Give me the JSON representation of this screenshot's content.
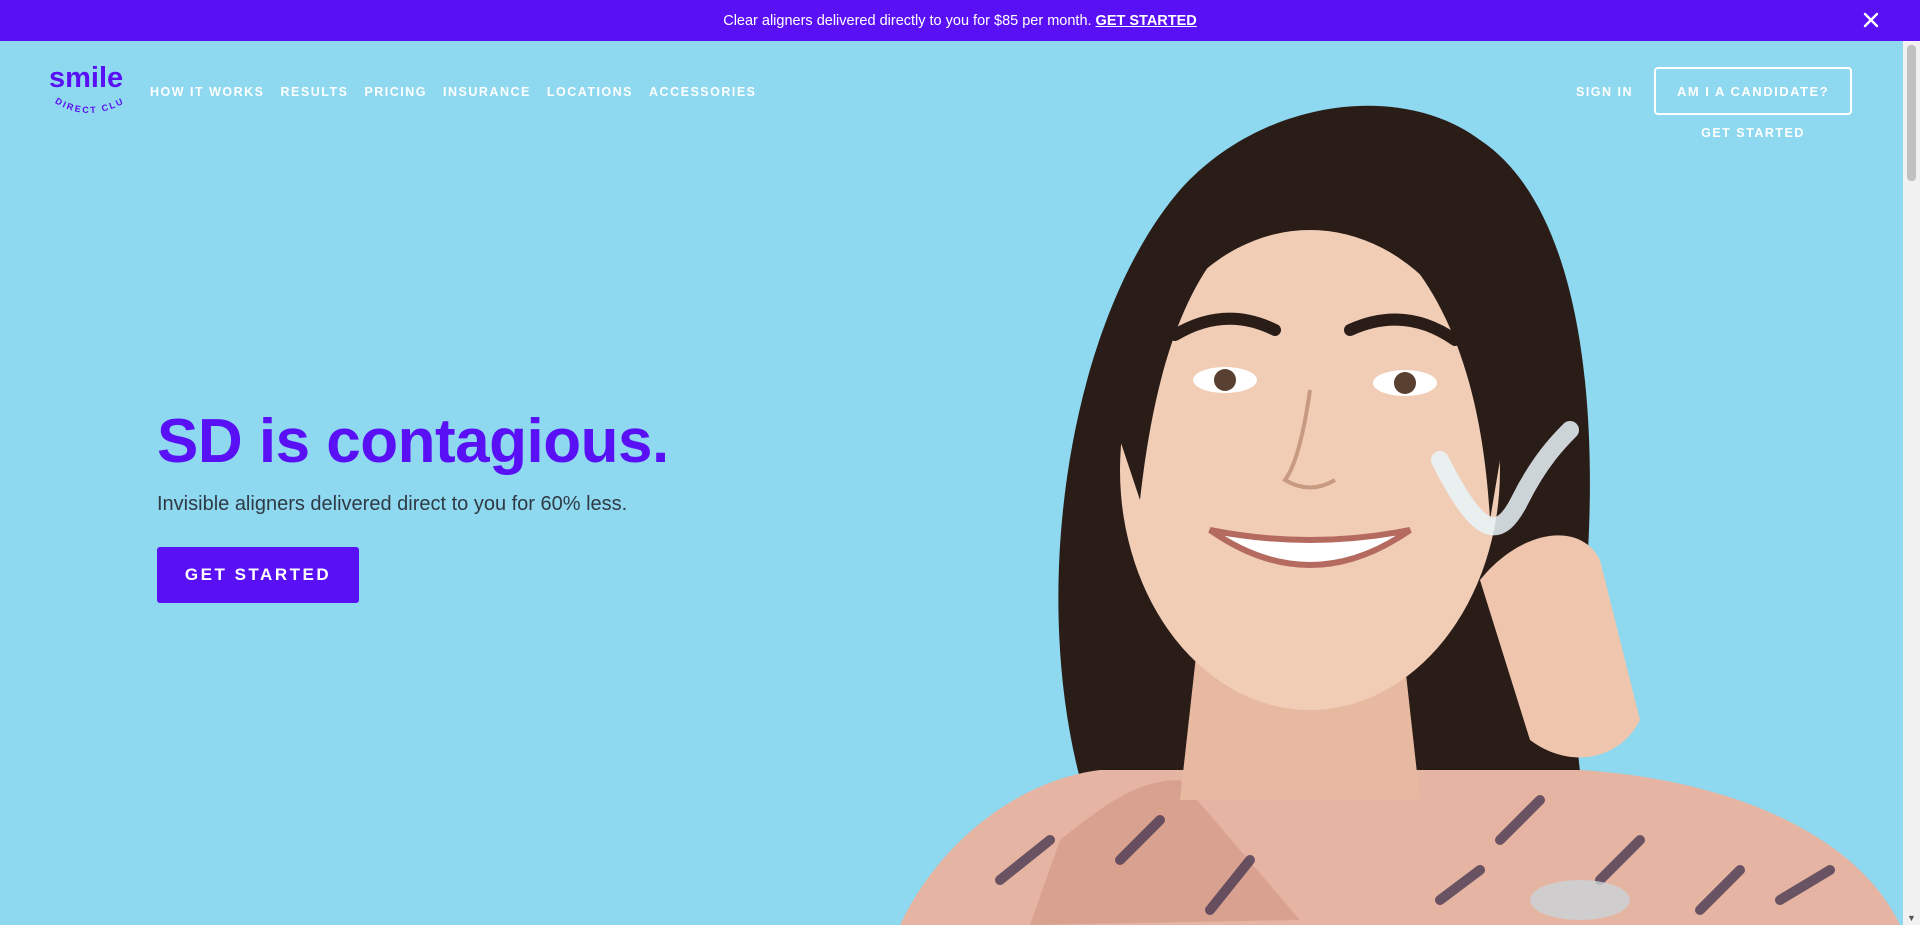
{
  "promo": {
    "text": "Clear aligners delivered directly to you for $85 per month.",
    "cta": "GET STARTED",
    "close_icon": "close-icon"
  },
  "logo": {
    "word": "smile",
    "tagline": "DIRECT CLUB"
  },
  "nav": {
    "items": [
      "HOW IT WORKS",
      "RESULTS",
      "PRICING",
      "INSURANCE",
      "LOCATIONS",
      "ACCESSORIES"
    ]
  },
  "account": {
    "sign_in": "SIGN IN",
    "candidate_button": "AM I A CANDIDATE?",
    "get_started": "GET STARTED"
  },
  "hero": {
    "title": "SD is contagious.",
    "subtitle": "Invisible aligners delivered direct to you for 60% less.",
    "cta": "GET STARTED",
    "image": "smiling-woman-holding-clear-aligner"
  },
  "colors": {
    "brand_purple": "#5a10f5",
    "hero_background": "#8ed8f0",
    "text_dark": "#2f3a45",
    "white": "#ffffff"
  }
}
